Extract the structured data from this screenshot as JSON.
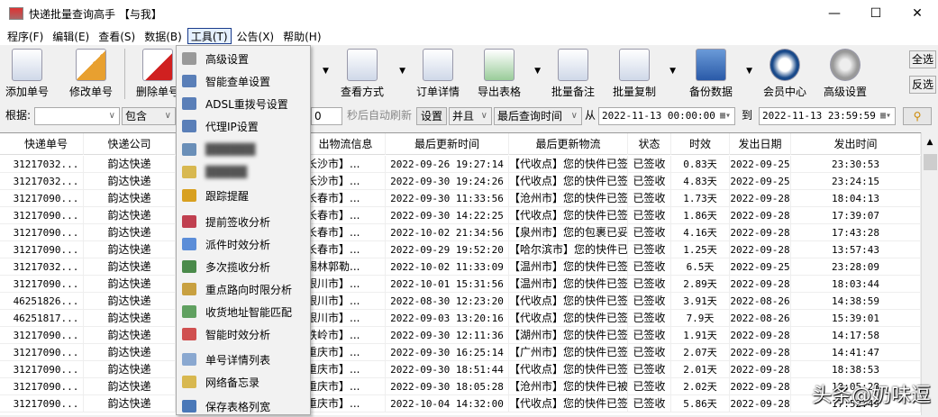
{
  "window": {
    "title": "快递批量查询高手 【与我】",
    "minimize": "—",
    "maximize": "☐",
    "close": "✕"
  },
  "menubar": [
    "程序(F)",
    "编辑(E)",
    "查看(S)",
    "数据(B)",
    "工具(T)",
    "公告(X)",
    "帮助(H)"
  ],
  "toolbar": {
    "add": "添加单号",
    "edit": "修改单号",
    "delete": "删除单号",
    "view": "查看方式",
    "detail": "订单详情",
    "export": "导出表格",
    "note": "批量备注",
    "copy": "批量复制",
    "backup": "备份数据",
    "member": "会员中心",
    "settings": "高级设置",
    "select_all": "全选",
    "invert": "反选"
  },
  "filter": {
    "label": "根据:",
    "field": "",
    "op": "包含",
    "refresh_value": "0",
    "refresh_label": "秒后自动刷新",
    "set": "设置",
    "logic": "并且",
    "time_field": "最后查询时间",
    "from": "从",
    "from_value": "2022-11-13 00:00:00",
    "to": "到",
    "to_value": "2022-11-13 23:59:59"
  },
  "tools_menu": [
    {
      "label": "高级设置",
      "color": "#999"
    },
    {
      "label": "智能查单设置",
      "color": "#5a7fb8"
    },
    {
      "label": "ADSL重拨号设置",
      "color": "#5a7fb8"
    },
    {
      "label": "代理IP设置",
      "color": "#5a7fb8"
    },
    {
      "label": "██████",
      "color": "#6a8fb8",
      "blur": true
    },
    {
      "label": "█████",
      "color": "#d8b850",
      "blur": true
    },
    {
      "label": "跟踪提醒",
      "color": "#d8a020"
    },
    {
      "label": "提前签收分析",
      "color": "#c04050"
    },
    {
      "label": "派件时效分析",
      "color": "#5b8dd8"
    },
    {
      "label": "多次揽收分析",
      "color": "#4a8a4a"
    },
    {
      "label": "重点路向时限分析",
      "color": "#c8a040"
    },
    {
      "label": "收货地址智能匹配",
      "color": "#60a060"
    },
    {
      "label": "智能时效分析",
      "color": "#d05050"
    },
    {
      "label": "单号详情列表",
      "color": "#8aa8d0"
    },
    {
      "label": "网络备忘录",
      "color": "#d8b850"
    },
    {
      "label": "保存表格列宽",
      "color": "#4a78b8"
    }
  ],
  "table": {
    "headers": [
      "快递单号",
      "快递公司",
      "出物流信息",
      "最后更新时间",
      "最后更新物流",
      "状态",
      "时效",
      "发出日期",
      "发出时间"
    ],
    "rows": [
      [
        "31217032...",
        "韵达快递",
        "长沙市】...",
        "2022-09-26 19:27:14",
        "【代收点】您的快件已签收...",
        "已签收",
        "0.83天",
        "2022-09-25",
        "23:30:53"
      ],
      [
        "31217032...",
        "韵达快递",
        "长沙市】...",
        "2022-09-30 19:24:26",
        "【代收点】您的快件已签收...",
        "已签收",
        "4.83天",
        "2022-09-25",
        "23:24:15"
      ],
      [
        "31217090...",
        "韵达快递",
        "长春市】...",
        "2022-09-30 11:33:56",
        "【沧州市】您的快件已签收...",
        "已签收",
        "1.73天",
        "2022-09-28",
        "18:04:13"
      ],
      [
        "31217090...",
        "韵达快递",
        "长春市】...",
        "2022-09-30 14:22:25",
        "【代收点】您的快件已签收...",
        "已签收",
        "1.86天",
        "2022-09-28",
        "17:39:07"
      ],
      [
        "31217090...",
        "韵达快递",
        "长春市】...",
        "2022-10-02 21:34:56",
        "【泉州市】您的包裹已妥投...",
        "已签收",
        "4.16天",
        "2022-09-28",
        "17:43:28"
      ],
      [
        "31217090...",
        "韵达快递",
        "长春市】...",
        "2022-09-29 19:52:20",
        "【哈尔滨市】您的快件已签...",
        "已签收",
        "1.25天",
        "2022-09-28",
        "13:57:43"
      ],
      [
        "31217032...",
        "韵达快递",
        "锡林郭勒...",
        "2022-10-02 11:33:09",
        "【温州市】您的快件已签收...",
        "已签收",
        "6.5天",
        "2022-09-25",
        "23:28:09"
      ],
      [
        "31217090...",
        "韵达快递",
        "银川市】...",
        "2022-10-01 15:31:56",
        "【温州市】您的快件已签收...",
        "已签收",
        "2.89天",
        "2022-09-28",
        "18:03:44"
      ],
      [
        "46251826...",
        "韵达快递",
        "银川市】...",
        "2022-08-30 12:23:20",
        "【代收点】您的快件已签收...",
        "已签收",
        "3.91天",
        "2022-08-26",
        "14:38:59"
      ],
      [
        "46251817...",
        "韵达快递",
        "银川市】...",
        "2022-09-03 13:20:16",
        "【代收点】您的快件已签收...",
        "已签收",
        "7.9天",
        "2022-08-26",
        "15:39:01"
      ],
      [
        "31217090...",
        "韵达快递",
        "铁岭市】...",
        "2022-09-30 12:11:36",
        "【湖州市】您的快件已签收...",
        "已签收",
        "1.91天",
        "2022-09-28",
        "14:17:58"
      ],
      [
        "31217090...",
        "韵达快递",
        "重庆市】...",
        "2022-09-30 16:25:14",
        "【广州市】您的快件已签收...",
        "已签收",
        "2.07天",
        "2022-09-28",
        "14:41:47"
      ],
      [
        "31217090...",
        "韵达快递",
        "重庆市】...",
        "2022-09-30 18:51:44",
        "【代收点】您的快件已签收...",
        "已签收",
        "2.01天",
        "2022-09-28",
        "18:38:53"
      ],
      [
        "31217090...",
        "韵达快递",
        "重庆市】...",
        "2022-09-30 18:05:28",
        "【沧州市】您的快件已被 寓...",
        "已签收",
        "2.02天",
        "2022-09-28",
        "18:05:28"
      ],
      [
        "31217090...",
        "韵达快递",
        "重庆市】...",
        "2022-10-04 14:32:00",
        "【代收点】您的快件已签收...",
        "已签收",
        "5.86天",
        "2022-09-28",
        "17:52:49"
      ]
    ]
  },
  "watermark": "头条@奶味逗"
}
